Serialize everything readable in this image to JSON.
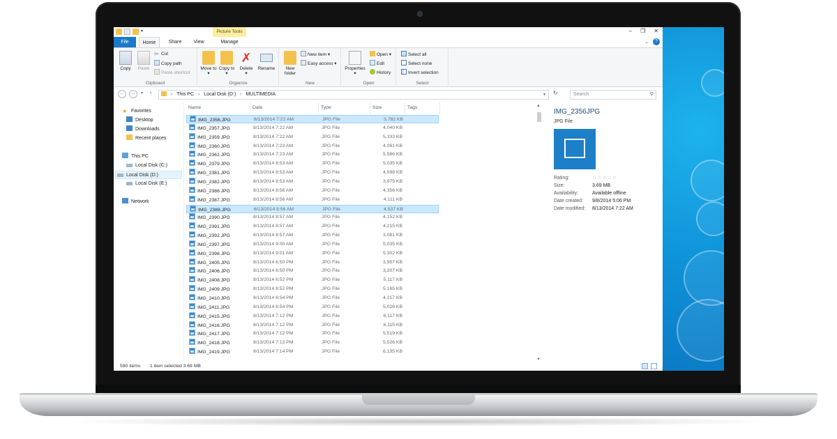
{
  "titlebar": {
    "contextual_tab": "Picture Tools"
  },
  "ribbon_tabs": [
    "File",
    "Home",
    "Share",
    "View",
    "Manage"
  ],
  "ribbon": {
    "clipboard": {
      "label": "Clipboard",
      "copy": "Copy",
      "paste": "Paste",
      "cut": "Cut",
      "copy_path": "Copy path",
      "paste_shortcut": "Paste shortcut"
    },
    "organize": {
      "label": "Organize",
      "move_to": "Move to",
      "copy_to": "Copy to",
      "delete": "Delete",
      "rename": "Rename"
    },
    "new": {
      "label": "New",
      "new_folder": "New folder",
      "new_item": "New item",
      "easy_access": "Easy access"
    },
    "open": {
      "label": "Open",
      "properties": "Properties",
      "open": "Open",
      "edit": "Edit",
      "history": "History"
    },
    "select": {
      "label": "Select",
      "select_all": "Select all",
      "select_none": "Select none",
      "invert_selection": "Invert selection"
    }
  },
  "address": {
    "crumbs": [
      "This PC",
      "Local Disk (D:)",
      "MULTIMEDIA"
    ],
    "search_placeholder": "Search"
  },
  "nav_pane": {
    "favorites": "Favorites",
    "desktop": "Desktop",
    "downloads": "Downloads",
    "recent": "Recent places",
    "this_pc": "This PC",
    "disk_c": "Local Disk (C:)",
    "disk_d": "Local Disk (D:)",
    "disk_e": "Local Disk (E:)",
    "network": "Network"
  },
  "columns": [
    "Name",
    "Date",
    "Type",
    "Size",
    "Tags"
  ],
  "files": [
    {
      "name": "IMG_2356.JPG",
      "date": "8/13/2014 7:22 AM",
      "type": "JPG File",
      "size": "3,782 KB",
      "selected": true
    },
    {
      "name": "IMG_2357.JPG",
      "date": "8/13/2014 7:22 AM",
      "type": "JPG File",
      "size": "4,040 KB"
    },
    {
      "name": "IMG_2359.JPG",
      "date": "8/13/2014 7:22 AM",
      "type": "JPG File",
      "size": "5,333 KB"
    },
    {
      "name": "IMG_2360.JPG",
      "date": "8/13/2014 7:23 AM",
      "type": "JPG File",
      "size": "4,061 KB"
    },
    {
      "name": "IMG_2362.JPG",
      "date": "8/13/2014 7:23 AM",
      "type": "JPG File",
      "size": "5,586 KB"
    },
    {
      "name": "IMG_2379.JPG",
      "date": "8/13/2014 8:53 AM",
      "type": "JPG File",
      "size": "5,035 KB"
    },
    {
      "name": "IMG_2381.JPG",
      "date": "8/13/2014 8:53 AM",
      "type": "JPG File",
      "size": "4,598 KB"
    },
    {
      "name": "IMG_2382.JPG",
      "date": "8/13/2014 8:53 AM",
      "type": "JPG File",
      "size": "3,975 KB"
    },
    {
      "name": "IMG_2386.JPG",
      "date": "8/13/2014 8:56 AM",
      "type": "JPG File",
      "size": "4,356 KB"
    },
    {
      "name": "IMG_2387.JPG",
      "date": "8/13/2014 8:56 AM",
      "type": "JPG File",
      "size": "4,111 KB"
    },
    {
      "name": "IMG_2388.JPG",
      "date": "8/13/2014 8:56 AM",
      "type": "JPG File",
      "size": "4,537 KB",
      "hover": true
    },
    {
      "name": "IMG_2390.JPG",
      "date": "8/13/2014 8:57 AM",
      "type": "JPG File",
      "size": "4,152 KB"
    },
    {
      "name": "IMG_2391.JPG",
      "date": "8/13/2014 8:57 AM",
      "type": "JPG File",
      "size": "4,215 KB"
    },
    {
      "name": "IMG_2392.JPG",
      "date": "8/13/2014 8:57 AM",
      "type": "JPG File",
      "size": "3,081 KB"
    },
    {
      "name": "IMG_2397.JPG",
      "date": "8/13/2014 9:00 AM",
      "type": "JPG File",
      "size": "5,035 KB"
    },
    {
      "name": "IMG_2398.JPG",
      "date": "8/13/2014 9:01 AM",
      "type": "JPG File",
      "size": "5,302 KB"
    },
    {
      "name": "IMG_2405.JPG",
      "date": "8/13/2014 6:50 PM",
      "type": "JPG File",
      "size": "3,957 KB"
    },
    {
      "name": "IMG_2406.JPG",
      "date": "8/13/2014 6:50 PM",
      "type": "JPG File",
      "size": "3,207 KB"
    },
    {
      "name": "IMG_2408.JPG",
      "date": "8/13/2014 6:52 PM",
      "type": "JPG File",
      "size": "5,117 KB"
    },
    {
      "name": "IMG_2409.JPG",
      "date": "8/13/2014 6:52 PM",
      "type": "JPG File",
      "size": "5,165 KB"
    },
    {
      "name": "IMG_2410.JPG",
      "date": "8/13/2014 6:54 PM",
      "type": "JPG File",
      "size": "4,217 KB"
    },
    {
      "name": "IMG_2411.JPG",
      "date": "8/13/2014 6:54 PM",
      "type": "JPG File",
      "size": "5,026 KB"
    },
    {
      "name": "IMG_2415.JPG",
      "date": "8/13/2014 7:12 PM",
      "type": "JPG File",
      "size": "6,117 KB"
    },
    {
      "name": "IMG_2416.JPG",
      "date": "8/13/2014 7:12 PM",
      "type": "JPG File",
      "size": "6,115 KB"
    },
    {
      "name": "IMG_2417.JPG",
      "date": "8/13/2014 7:12 PM",
      "type": "JPG File",
      "size": "5,519 KB"
    },
    {
      "name": "IMG_2418.JPG",
      "date": "8/13/2014 7:13 PM",
      "type": "JPG File",
      "size": "5,526 KB"
    },
    {
      "name": "IMG_2419.JPG",
      "date": "8/13/2014 7:14 PM",
      "type": "JPG File",
      "size": "6,135 KB"
    }
  ],
  "details": {
    "title": "IMG_2356JPG",
    "type": "JPG File",
    "rating_label": "Rating:",
    "rating_stars": "☆☆☆☆☆",
    "size_label": "Size:",
    "size": "3.69 MB",
    "availability_label": "Availability:",
    "availability": "Available offline",
    "created_label": "Date created:",
    "created": "9/8/2014 5:06 PM",
    "modified_label": "Date modified:",
    "modified": "8/13/2014 7:22 AM"
  },
  "status": {
    "item_count": "590 items",
    "selection": "1 item selected  3.69 MB"
  },
  "colors": {
    "accent": "#1979ca",
    "selection": "#cce8ff",
    "desktop": "#0e8fd6"
  }
}
